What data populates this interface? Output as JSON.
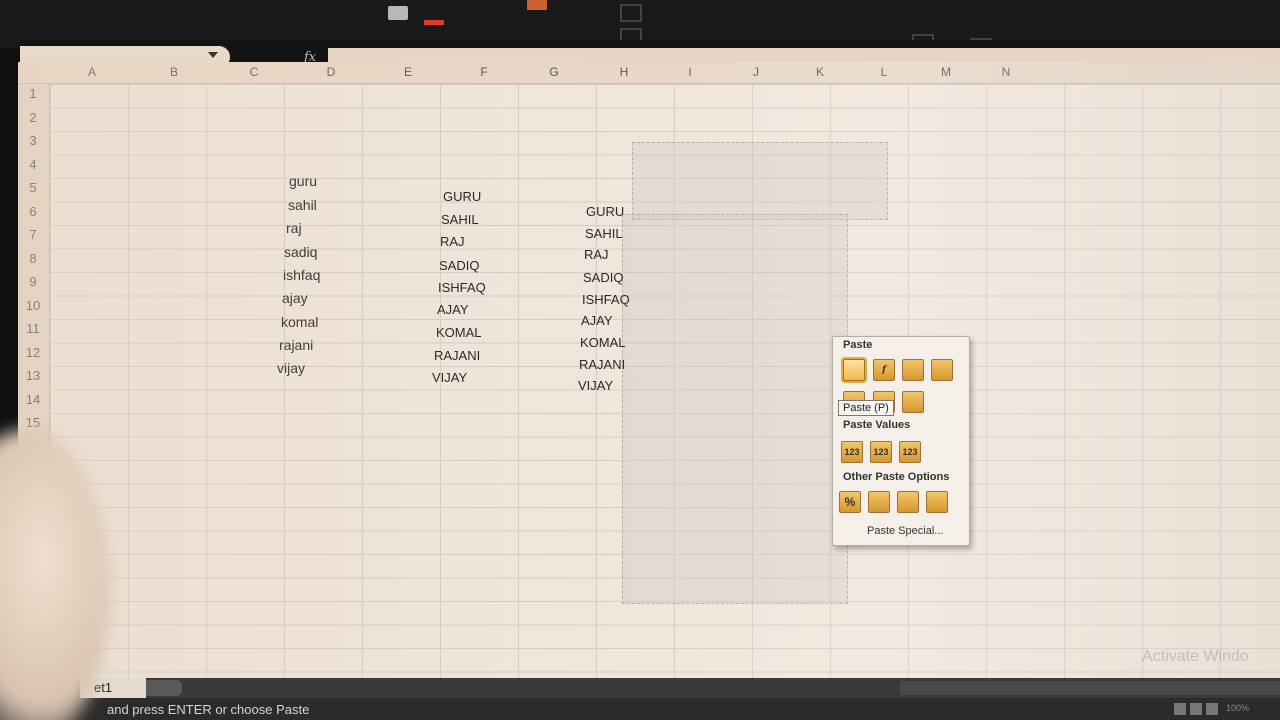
{
  "formula_bar": {
    "fx_label": "fx",
    "value": ""
  },
  "columns": [
    "A",
    "B",
    "C",
    "D",
    "E",
    "F",
    "G",
    "H",
    "I",
    "J",
    "K",
    "L",
    "M",
    "N"
  ],
  "rows": [
    "1",
    "2",
    "3",
    "4",
    "5",
    "6",
    "7",
    "8",
    "9",
    "10",
    "11",
    "12",
    "13",
    "14",
    "15"
  ],
  "col_d": [
    "guru",
    "sahil",
    "raj",
    "sadiq",
    "ishfaq",
    "ajay",
    "komal",
    "rajani",
    "vijay"
  ],
  "col_f": [
    "GURU",
    "SAHIL",
    "RAJ",
    "SADIQ",
    "ISHFAQ",
    "AJAY",
    "KOMAL",
    "RAJANI",
    "VIJAY"
  ],
  "col_h": [
    "GURU",
    "SAHIL",
    "RAJ",
    "SADIQ",
    "ISHFAQ",
    "AJAY",
    "KOMAL",
    "RAJANI",
    "VIJAY"
  ],
  "paste_menu": {
    "paste_heading": "Paste",
    "paste_values_heading": "Paste Values",
    "other_heading": "Other Paste Options",
    "paste_special": "Paste Special...",
    "tooltip": "Paste (P)",
    "value_icon_label": "123",
    "percent_icon_label": "%"
  },
  "sheet_tab": "et1",
  "status_text": "and press ENTER or choose Paste",
  "watermark": "Activate Windo",
  "zoom": "100%"
}
